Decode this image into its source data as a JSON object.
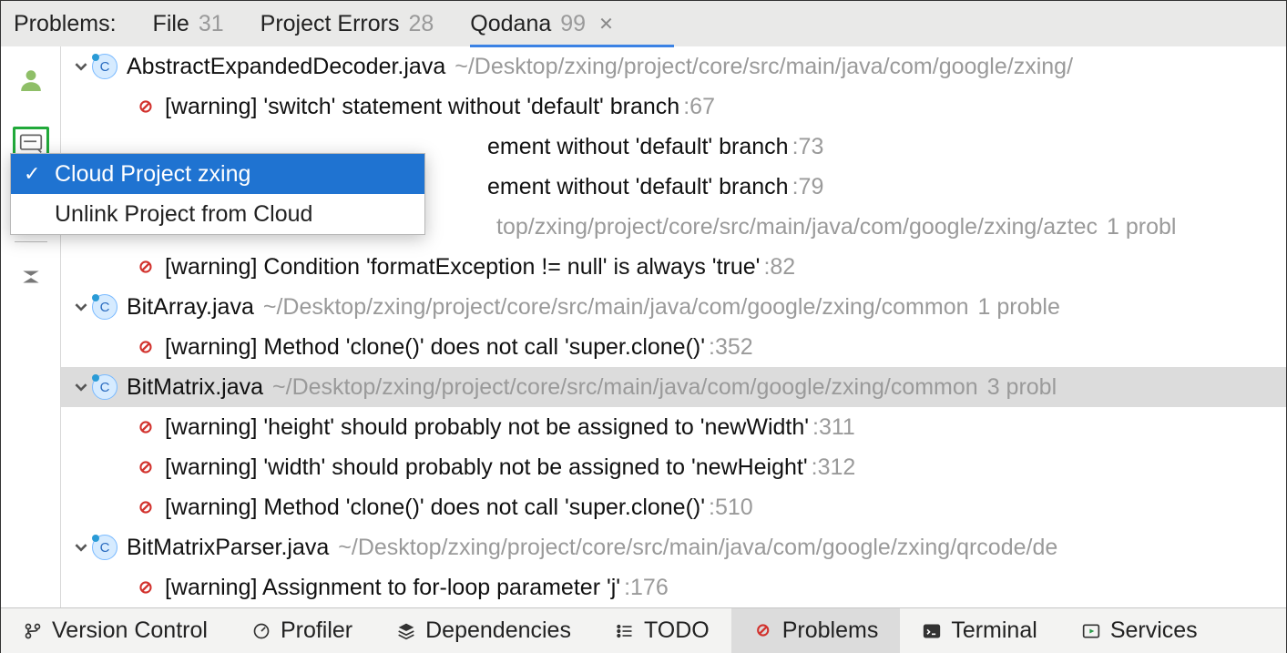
{
  "tabs": {
    "label": "Problems:",
    "items": [
      {
        "name": "File",
        "count": "31"
      },
      {
        "name": "Project Errors",
        "count": "28"
      },
      {
        "name": "Qodana",
        "count": "99"
      }
    ],
    "activeIndex": 2
  },
  "popup": {
    "items": [
      {
        "label": "Cloud Project zxing",
        "checked": true,
        "selected": true
      },
      {
        "label": "Unlink Project from Cloud",
        "checked": false,
        "selected": false
      }
    ]
  },
  "tree": [
    {
      "type": "file",
      "name": "AbstractExpandedDecoder.java",
      "path": "~/Desktop/zxing/project/core/src/main/java/com/google/zxing/",
      "trailing": ""
    },
    {
      "type": "warn",
      "msg": "[warning] 'switch' statement without 'default' branch",
      "loc": ":67"
    },
    {
      "type": "warn_cut",
      "msg": "ement without 'default' branch",
      "loc": ":73"
    },
    {
      "type": "warn_cut",
      "msg": "ement without 'default' branch",
      "loc": ":79"
    },
    {
      "type": "path_cut",
      "path": "top/zxing/project/core/src/main/java/com/google/zxing/aztec",
      "trailing": "  1 probl"
    },
    {
      "type": "warn",
      "msg": "[warning] Condition 'formatException != null' is always 'true'",
      "loc": ":82"
    },
    {
      "type": "file",
      "name": "BitArray.java",
      "path": "~/Desktop/zxing/project/core/src/main/java/com/google/zxing/common",
      "trailing": "  1 proble"
    },
    {
      "type": "warn",
      "msg": "[warning] Method 'clone()' does not call 'super.clone()'",
      "loc": ":352"
    },
    {
      "type": "file",
      "name": "BitMatrix.java",
      "path": "~/Desktop/zxing/project/core/src/main/java/com/google/zxing/common",
      "trailing": "  3 probl",
      "selected": true
    },
    {
      "type": "warn",
      "msg": "[warning] 'height' should probably not be assigned to 'newWidth'",
      "loc": ":311"
    },
    {
      "type": "warn",
      "msg": "[warning] 'width' should probably not be assigned to 'newHeight'",
      "loc": ":312"
    },
    {
      "type": "warn",
      "msg": "[warning] Method 'clone()' does not call 'super.clone()'",
      "loc": ":510"
    },
    {
      "type": "file",
      "name": "BitMatrixParser.java",
      "path": "~/Desktop/zxing/project/core/src/main/java/com/google/zxing/qrcode/de",
      "trailing": ""
    },
    {
      "type": "warn",
      "msg": "[warning] Assignment to for-loop parameter 'j'",
      "loc": ":176"
    }
  ],
  "bottom": [
    {
      "label": "Version Control",
      "icon": "branch"
    },
    {
      "label": "Profiler",
      "icon": "gauge"
    },
    {
      "label": "Dependencies",
      "icon": "layers"
    },
    {
      "label": "TODO",
      "icon": "list"
    },
    {
      "label": "Problems",
      "icon": "warn",
      "active": true
    },
    {
      "label": "Terminal",
      "icon": "terminal"
    },
    {
      "label": "Services",
      "icon": "play"
    }
  ]
}
